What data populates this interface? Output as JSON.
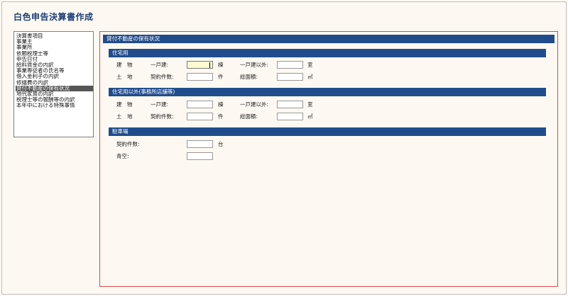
{
  "page": {
    "title": "白色申告決算書作成"
  },
  "nav": {
    "items": [
      {
        "label": "決算書項目"
      },
      {
        "label": "事業主"
      },
      {
        "label": "事業所"
      },
      {
        "label": "依頼税理士等"
      },
      {
        "label": "申告日付"
      },
      {
        "label": "給料賃金の内訳"
      },
      {
        "label": "事業専従者の氏名等"
      },
      {
        "label": "借入金利子の内訳"
      },
      {
        "label": "修繕費の内訳"
      },
      {
        "label": "貸付不動産の保有状況"
      },
      {
        "label": "地代家賃の内訳"
      },
      {
        "label": "税理士等の報酬等の内訳"
      },
      {
        "label": "本年中における特殊事情"
      }
    ],
    "selected_index": 9
  },
  "main": {
    "header": "貸付不動産の保有状況",
    "residential": {
      "title": "住宅用",
      "row1_label": "建　物",
      "detached_label": "一戸建:",
      "detached_value": "",
      "detached_unit": "棟",
      "non_detached_label": "一戸建以外:",
      "non_detached_value": "",
      "non_detached_unit": "室",
      "row2_label": "土　地",
      "contracts_label": "契約件数:",
      "contracts_value": "",
      "contracts_unit": "件",
      "area_label": "総面積:",
      "area_value": "",
      "area_unit": "㎡"
    },
    "non_residential": {
      "title": "住宅用以外(事務所店舗等)",
      "row1_label": "建　物",
      "detached_label": "一戸建:",
      "detached_value": "",
      "detached_unit": "棟",
      "non_detached_label": "一戸建以外:",
      "non_detached_value": "",
      "non_detached_unit": "室",
      "row2_label": "土　地",
      "contracts_label": "契約件数:",
      "contracts_value": "",
      "contracts_unit": "件",
      "area_label": "総面積:",
      "area_value": "",
      "area_unit": "㎡"
    },
    "parking": {
      "title": "駐車場",
      "contracts_label": "契約件数:",
      "contracts_value": "",
      "contracts_unit": "台",
      "open_label": "青空:",
      "open_value": ""
    }
  }
}
